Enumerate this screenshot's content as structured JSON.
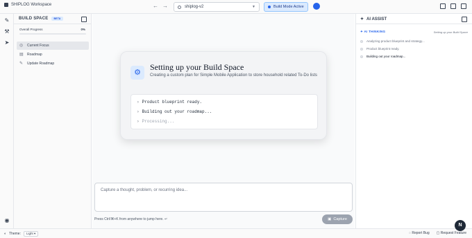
{
  "app": {
    "workspace_title": "SHIPLOG Workspace",
    "back_arrow": "←",
    "forward_arrow": "→"
  },
  "search": {
    "value": "shiplog-v2"
  },
  "build_mode": {
    "label": "Build Mode Active"
  },
  "rail": {
    "icons": [
      "pencil-icon",
      "wrench-icon",
      "send-icon",
      "user-icon"
    ]
  },
  "build_space": {
    "title": "BUILD SPACE",
    "badge": "BETA",
    "progress_label": "Overall Progress",
    "progress_value": "0%",
    "progress_fraction": 0,
    "items": [
      {
        "label": "Current Focus",
        "icon": "target-icon"
      },
      {
        "label": "Roadmap",
        "icon": "roadmap-icon"
      },
      {
        "label": "Update Roadmap",
        "icon": "edit-icon"
      }
    ]
  },
  "card": {
    "title": "Setting up your Build Space",
    "subtitle": "Creating a custom plan for Simple Mobile Application to store household related To-Do lists",
    "terminal": [
      "Product blueprint ready.",
      "Building out your roadmap...",
      "Processing..."
    ]
  },
  "capture": {
    "placeholder": "Capture a thought, problem, or recurring idea...",
    "hint": "Press Ctrl/⌘+K from anywhere to jump here.",
    "button": "Capture"
  },
  "ai_assist": {
    "title": "AI ASSIST",
    "thinking_label": "AI THINKING",
    "context": "Setting up your Build Space",
    "steps": [
      "Analyzing product blueprint and strategy...",
      "Product blueprint ready.",
      "Building out your roadmap..."
    ]
  },
  "status_bar": {
    "theme_label": "Theme:",
    "theme_value": "Light",
    "report_bug": "Report Bug",
    "request_feature": "Request Feature"
  },
  "fab": {
    "label": "N"
  }
}
